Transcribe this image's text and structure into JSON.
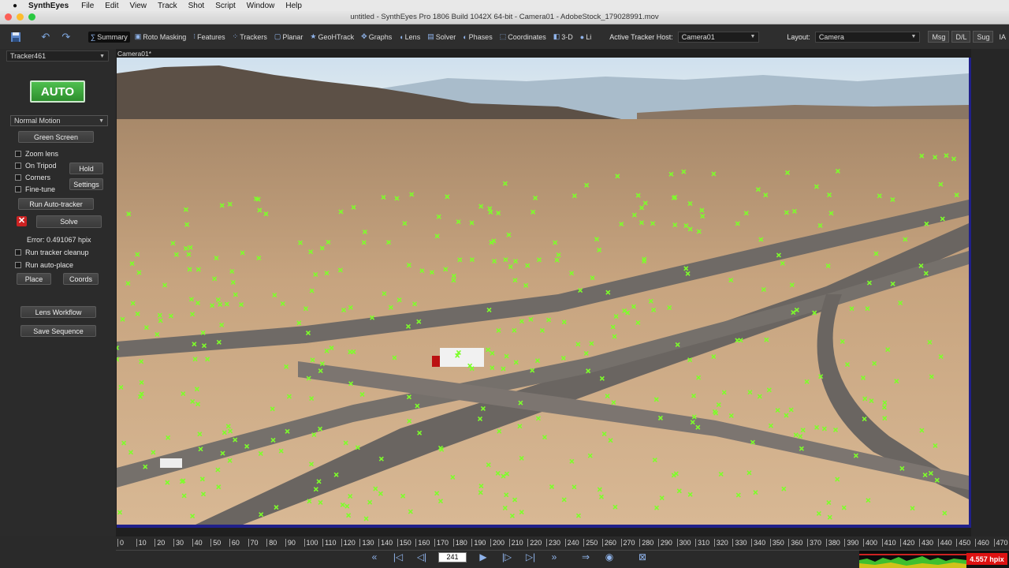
{
  "menubar": {
    "app_name": "SynthEyes",
    "items": [
      "File",
      "Edit",
      "View",
      "Track",
      "Shot",
      "Script",
      "Window",
      "Help"
    ]
  },
  "window": {
    "title": "untitled - SynthEyes Pro 1806 Build 1042X 64-bit - Camera01 - AdobeStock_179028991.mov"
  },
  "toolbar": {
    "tabs": [
      {
        "label": "Summary",
        "icon": "sigma-icon",
        "glyph": "∑",
        "active": true
      },
      {
        "label": "Roto Masking",
        "icon": "roto-icon",
        "glyph": "▣"
      },
      {
        "label": "Features",
        "icon": "features-icon",
        "glyph": "⁝"
      },
      {
        "label": "Trackers",
        "icon": "trackers-icon",
        "glyph": "⁘"
      },
      {
        "label": "Planar",
        "icon": "planar-icon",
        "glyph": "▢"
      },
      {
        "label": "GeoHTrack",
        "icon": "geohtrack-icon",
        "glyph": "★"
      },
      {
        "label": "Graphs",
        "icon": "graphs-icon",
        "glyph": "✥"
      },
      {
        "label": "Lens",
        "icon": "lens-icon",
        "glyph": "◖"
      },
      {
        "label": "Solver",
        "icon": "solver-icon",
        "glyph": "▤"
      },
      {
        "label": "Phases",
        "icon": "phases-icon",
        "glyph": "◐"
      },
      {
        "label": "Coordinates",
        "icon": "coordinates-icon",
        "glyph": "⬚"
      },
      {
        "label": "3-D",
        "icon": "3d-icon",
        "glyph": "◧"
      },
      {
        "label": "Li",
        "icon": "lighting-icon",
        "glyph": "●"
      }
    ],
    "active_tracker_host_label": "Active Tracker Host:",
    "active_tracker_host_value": "Camera01",
    "layout_label": "Layout:",
    "layout_value": "Camera",
    "msg": "Msg",
    "dl": "D/L",
    "sug": "Sug",
    "ia": "IA"
  },
  "left_panel": {
    "tracker_select": "Tracker461",
    "auto": "AUTO",
    "motion_select": "Normal Motion",
    "green_screen": "Green Screen",
    "zoom_lens": "Zoom lens",
    "on_tripod": "On Tripod",
    "hold": "Hold",
    "corners": "Corners",
    "settings": "Settings",
    "fine_tune": "Fine-tune",
    "run_auto_tracker": "Run Auto-tracker",
    "solve": "Solve",
    "error": "Error: 0.491067 hpix",
    "run_tracker_cleanup": "Run tracker cleanup",
    "run_auto_place": "Run auto-place",
    "place": "Place",
    "coords": "Coords",
    "lens_workflow": "Lens Workflow",
    "save_sequence": "Save Sequence"
  },
  "viewport": {
    "label": "Camera01*"
  },
  "timeline": {
    "ticks": [
      "0",
      "10",
      "20",
      "30",
      "40",
      "50",
      "60",
      "70",
      "80",
      "90",
      "100",
      "110",
      "120",
      "130",
      "140",
      "150",
      "160",
      "170",
      "180",
      "190",
      "200",
      "210",
      "220",
      "230",
      "240",
      "250",
      "260",
      "270",
      "280",
      "290",
      "300",
      "310",
      "320",
      "330",
      "340",
      "350",
      "360",
      "370",
      "380",
      "390",
      "400",
      "410",
      "420",
      "430",
      "440",
      "450",
      "460",
      "470"
    ],
    "current_frame": "241",
    "error_badge": "4.557 hpix"
  },
  "colors": {
    "tracker_marker": "#7dff2a",
    "auto_button": "#3aa33a",
    "frame_border": "#20208a",
    "error_badge": "#dd1111"
  }
}
